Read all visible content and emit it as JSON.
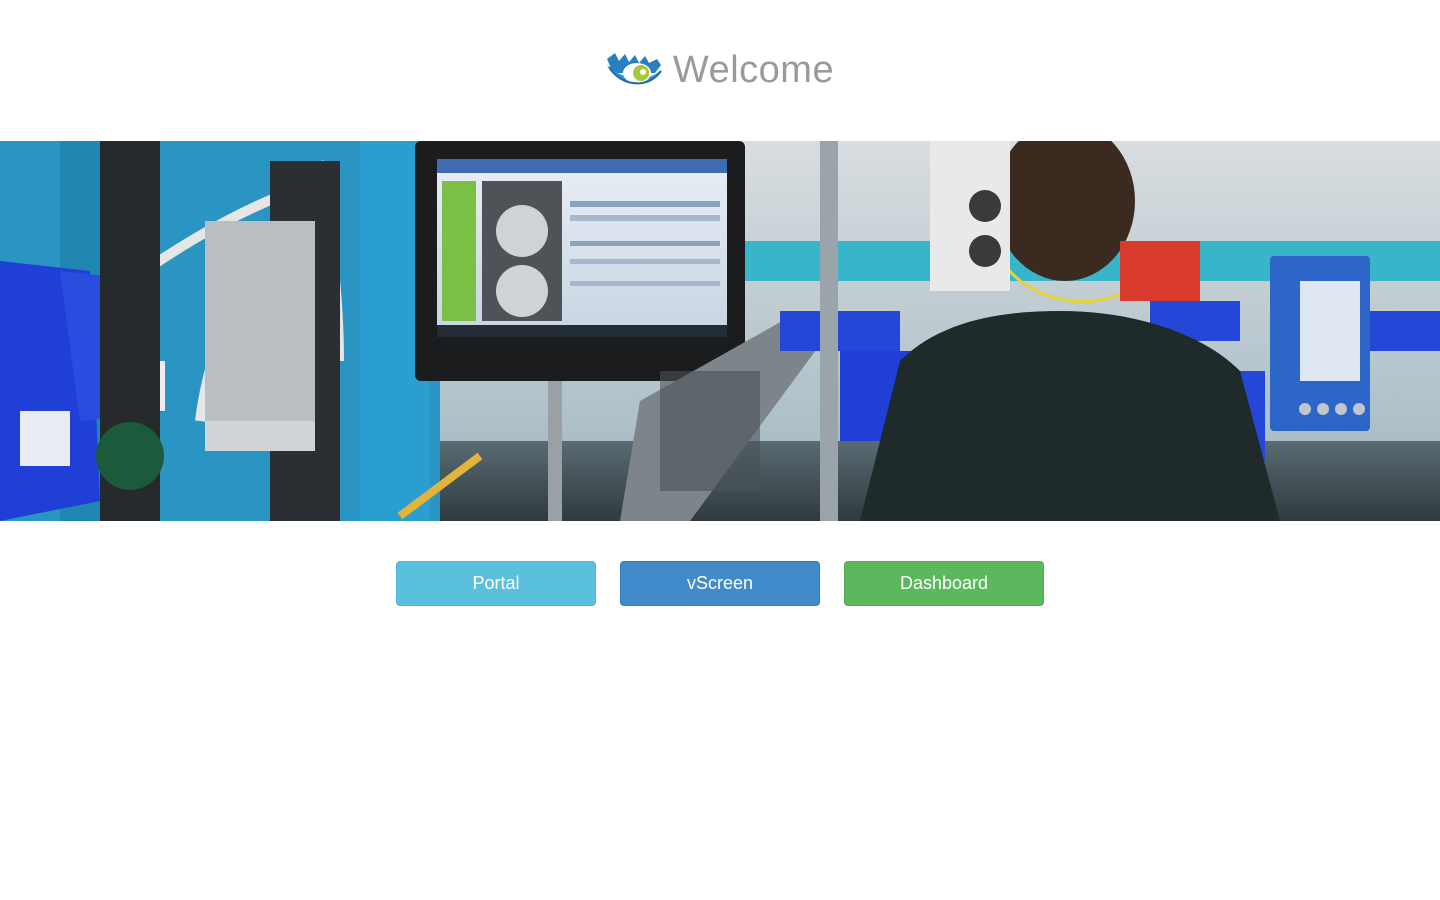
{
  "header": {
    "title": "Welcome",
    "logo_icon": "eye-logo-icon"
  },
  "hero": {
    "description_icon": "factory-floor-photo"
  },
  "buttons": {
    "portal_label": "Portal",
    "vscreen_label": "vScreen",
    "dashboard_label": "Dashboard"
  },
  "colors": {
    "portal": "#5bc0de",
    "vscreen": "#428bca",
    "dashboard": "#5cb85c",
    "title": "#9a9a9a"
  }
}
